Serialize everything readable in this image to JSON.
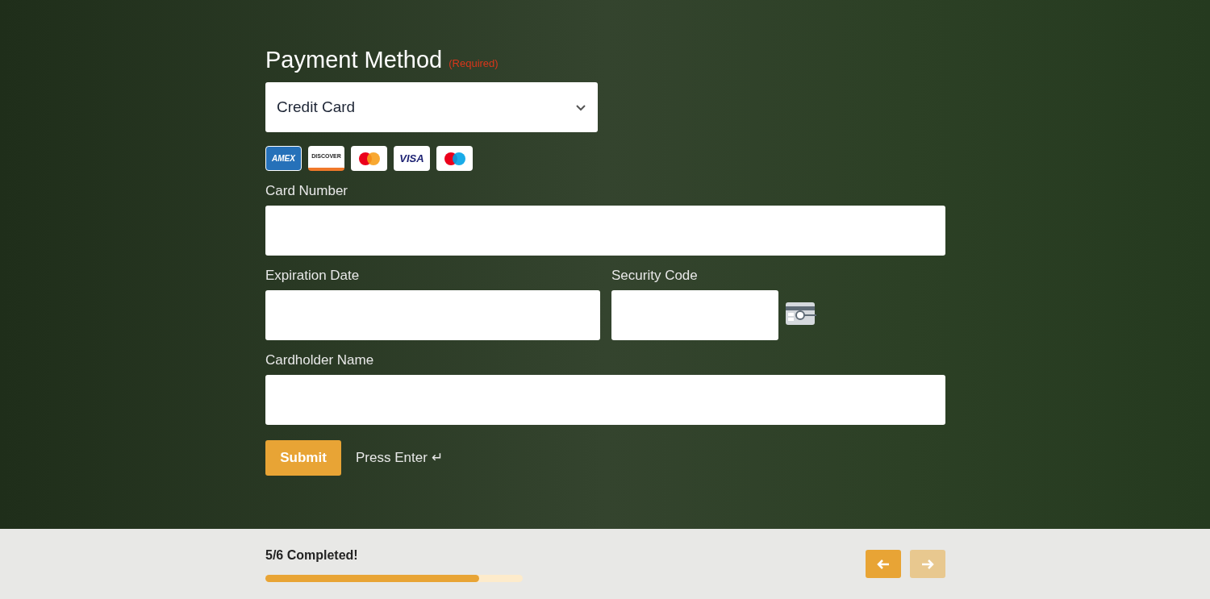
{
  "question": {
    "title": "Payment Method",
    "required_note": "(Required)"
  },
  "select": {
    "value": "Credit Card"
  },
  "cards": [
    {
      "kind": "amex",
      "label": "AMEX"
    },
    {
      "kind": "discover",
      "label": "DISCOVER"
    },
    {
      "kind": "mastercard"
    },
    {
      "kind": "visa",
      "label": "VISA"
    },
    {
      "kind": "maestro"
    }
  ],
  "fields": {
    "card_number": {
      "label": "Card Number"
    },
    "expiration": {
      "label": "Expiration Date"
    },
    "security": {
      "label": "Security Code"
    },
    "cardholder": {
      "label": "Cardholder Name"
    }
  },
  "submit": {
    "label": "Submit",
    "hint": "Press Enter ↵"
  },
  "footer": {
    "progress_text": "5/6 Completed!",
    "level": 0.83,
    "prev": {
      "disabled": false
    },
    "next": {
      "disabled": true
    }
  }
}
